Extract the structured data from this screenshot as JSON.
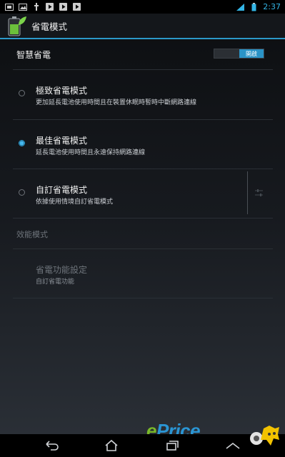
{
  "status_bar": {
    "time": "2:37"
  },
  "action_bar": {
    "title": "省電模式"
  },
  "smart_saving": {
    "label": "智慧省電",
    "toggle_label": "開啟",
    "toggle_state": "on"
  },
  "modes": [
    {
      "title": "極致省電模式",
      "summary": "更加延長電池使用時間且在裝置休眠時暫時中斷網路連線",
      "selected": false
    },
    {
      "title": "最佳省電模式",
      "summary": "延長電池使用時間且永遠保持網路連線",
      "selected": true
    },
    {
      "title": "自訂省電模式",
      "summary": "依據使用情境自訂省電模式",
      "selected": false
    }
  ],
  "performance": {
    "header": "效能模式"
  },
  "power_settings": {
    "title": "省電功能設定",
    "summary": "自訂省電功能"
  },
  "watermark": {
    "text_e": "e",
    "text_rest": "Price"
  },
  "colors": {
    "accent": "#33b5e5",
    "toggle_on": "#2a93c6",
    "background": "#0d0f12"
  }
}
